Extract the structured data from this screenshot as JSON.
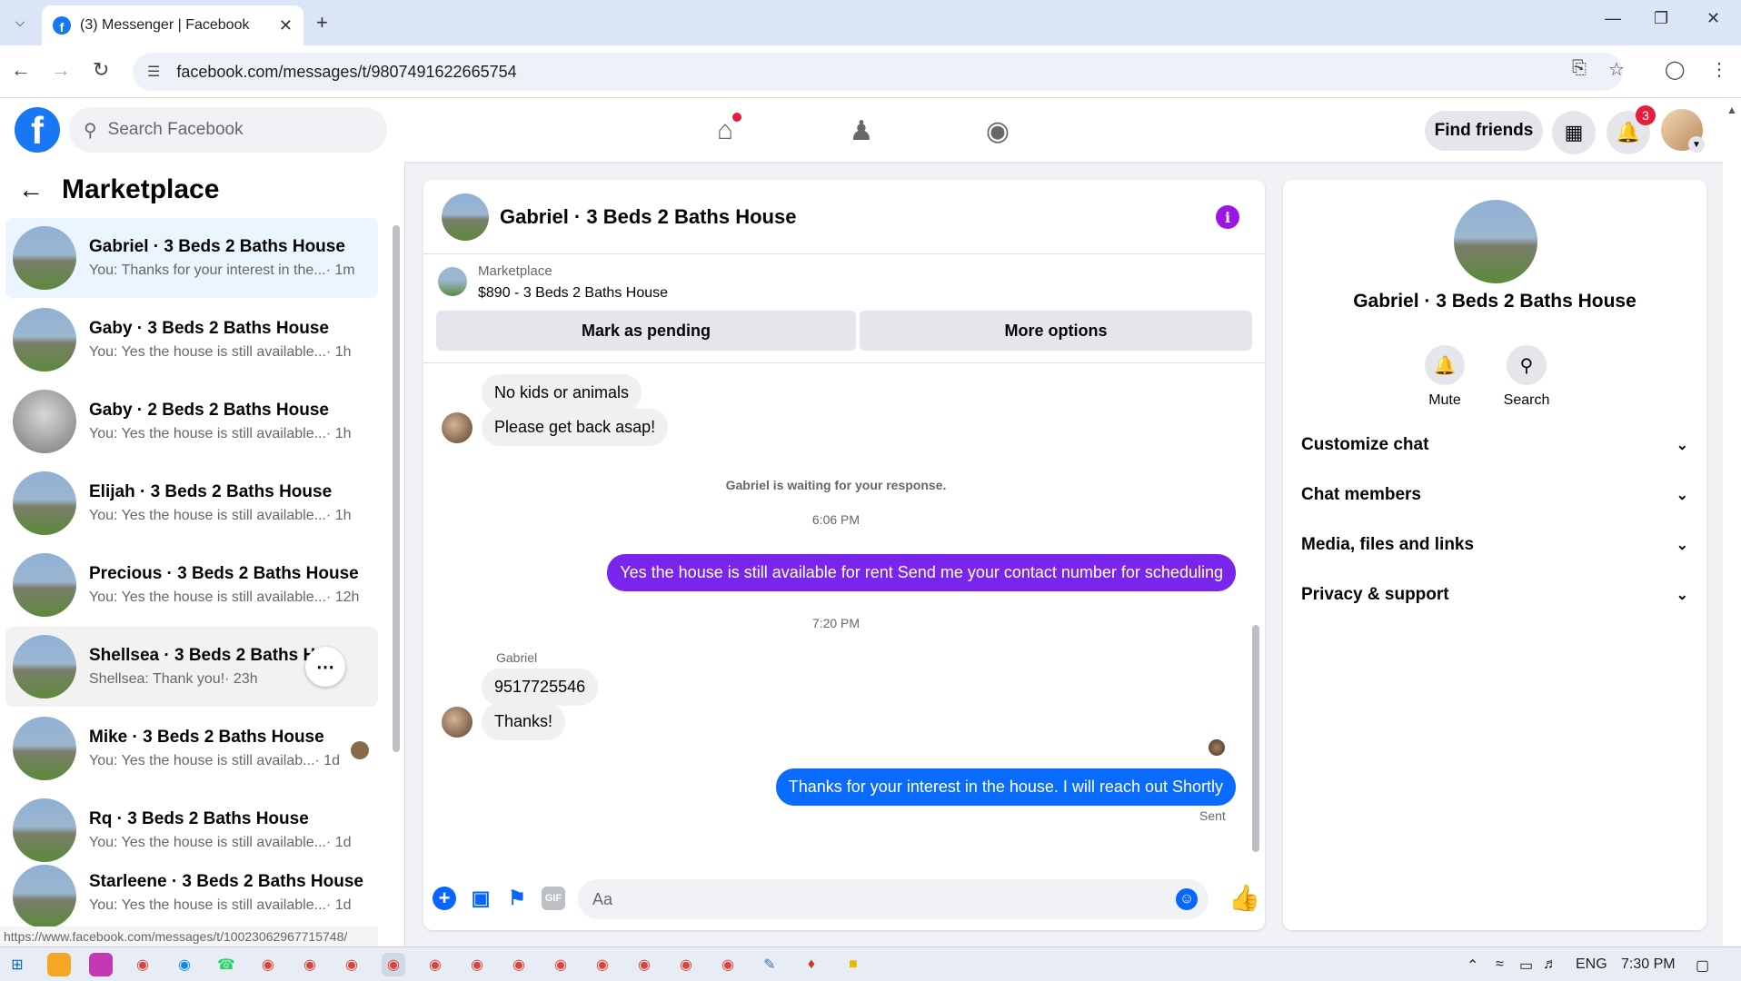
{
  "browser": {
    "tab_title": "(3) Messenger | Facebook",
    "url": "facebook.com/messages/t/9807491622665754",
    "status_url": "https://www.facebook.com/messages/t/10023062967715748/"
  },
  "header": {
    "search_placeholder": "Search Facebook",
    "find_friends": "Find friends",
    "notifications_count": "3"
  },
  "sidebar": {
    "title": "Marketplace",
    "conversations": [
      {
        "name": "Gabriel · 3 Beds 2 Baths House",
        "preview": "You: Thanks for your interest in the...",
        "time": "· 1m"
      },
      {
        "name": "Gaby · 3 Beds 2 Baths House",
        "preview": "You: Yes the house is still available...",
        "time": "· 1h"
      },
      {
        "name": "Gaby · 2 Beds 2 Baths House",
        "preview": "You: Yes the house is still available...",
        "time": "· 1h"
      },
      {
        "name": "Elijah · 3 Beds 2 Baths House",
        "preview": "You: Yes the house is still available...",
        "time": "· 1h"
      },
      {
        "name": "Precious · 3 Beds 2 Baths House",
        "preview": "You: Yes the house is still available...",
        "time": "· 12h"
      },
      {
        "name": "Shellsea · 3 Beds 2 Baths Ho",
        "preview": "Shellsea: Thank you!",
        "time": "· 23h"
      },
      {
        "name": "Mike · 3 Beds 2 Baths House",
        "preview": "You: Yes the house is still availab...",
        "time": "· 1d"
      },
      {
        "name": "Rq · 3 Beds 2 Baths House",
        "preview": "You: Yes the house is still available...",
        "time": "· 1d"
      },
      {
        "name": "Starleene · 3 Beds 2 Baths House",
        "preview": "You: Yes the house is still available...",
        "time": "· 1d"
      }
    ]
  },
  "chat": {
    "title": "Gabriel · 3 Beds 2 Baths House",
    "marketplace_label": "Marketplace",
    "listing": "$890 - 3 Beds 2 Baths House",
    "mark_pending": "Mark as pending",
    "more_options": "More options",
    "msg_no_kids": "No kids or animals",
    "msg_get_back": "Please get back asap!",
    "waiting": "Gabriel is waiting for your response.",
    "time1": "6:06 PM",
    "msg_out1": "Yes the house is still available for rent Send me your contact number for scheduling",
    "time2": "7:20 PM",
    "sender_name": "Gabriel",
    "msg_phone": "9517725546",
    "msg_thanks": "Thanks!",
    "msg_out2": "Thanks for your interest in the house. I will reach out Shortly",
    "sent_status": "Sent",
    "composer_placeholder": "Aa",
    "gif_label": "GIF"
  },
  "details": {
    "name": "Gabriel · 3 Beds 2 Baths House",
    "mute": "Mute",
    "search": "Search",
    "sections": [
      "Customize chat",
      "Chat members",
      "Media, files and links",
      "Privacy & support"
    ]
  },
  "taskbar": {
    "lang": "ENG",
    "time": "7:30 PM"
  }
}
